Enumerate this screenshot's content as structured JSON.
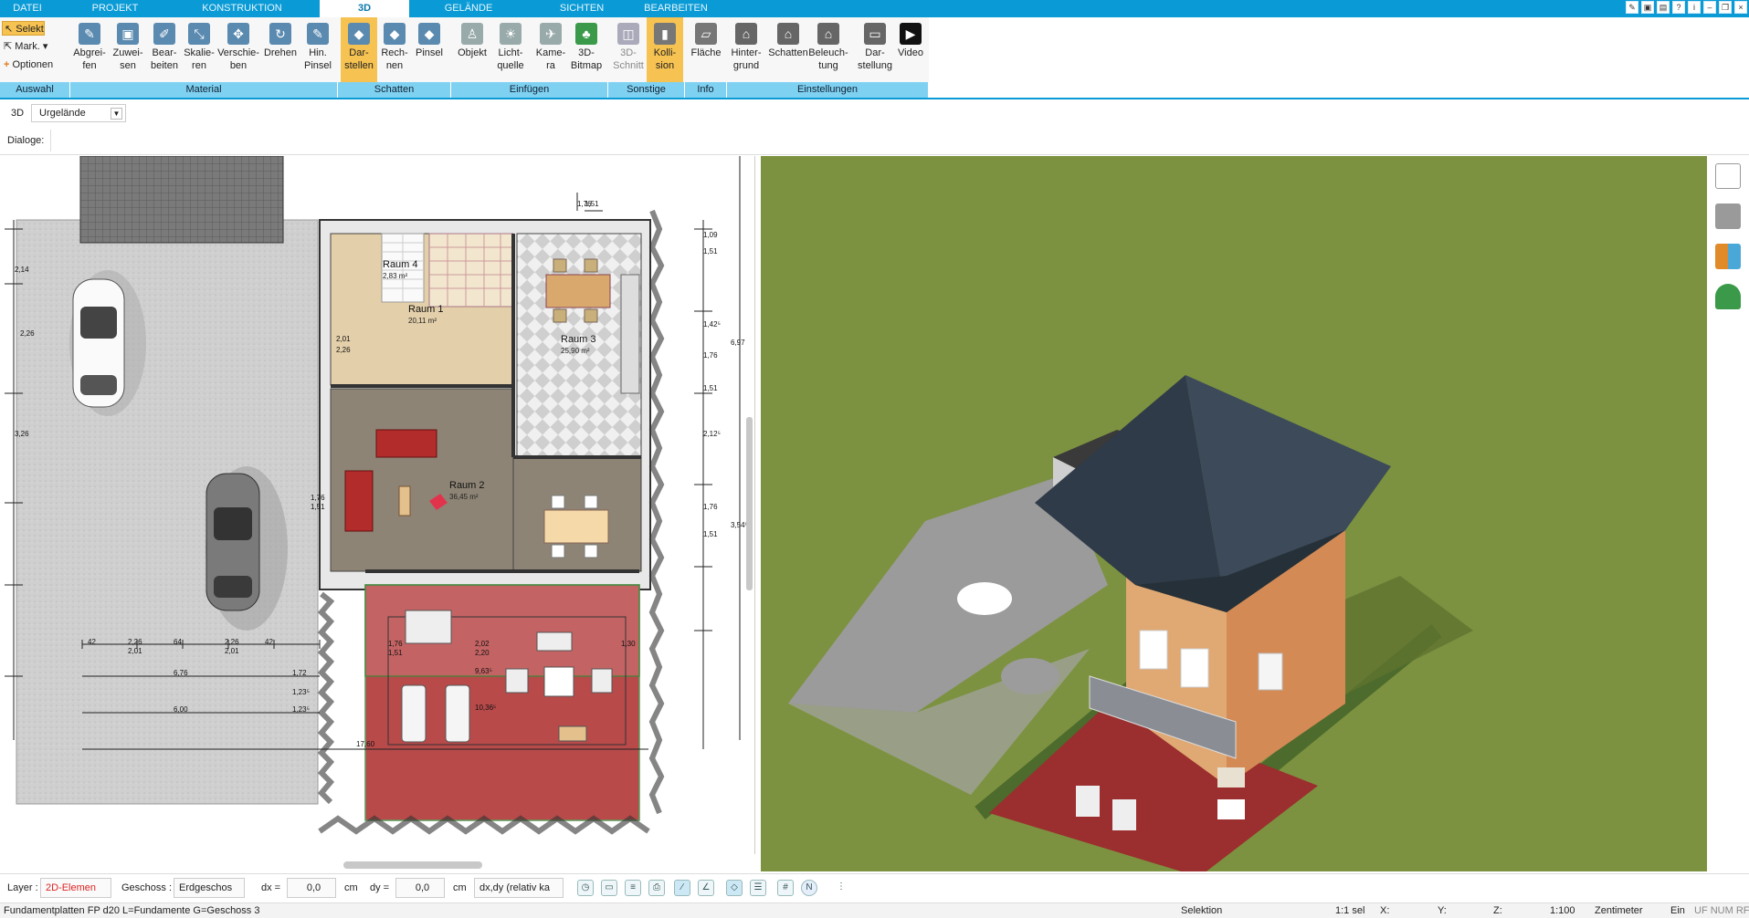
{
  "tabs": [
    {
      "label": "DATEI",
      "active": false
    },
    {
      "label": "PROJEKT",
      "active": false
    },
    {
      "label": "KONSTRUKTION",
      "active": false
    },
    {
      "label": "3D",
      "active": true
    },
    {
      "label": "GELÄNDE",
      "active": false
    },
    {
      "label": "SICHTEN",
      "active": false
    },
    {
      "label": "BEARBEITEN",
      "active": false
    }
  ],
  "selection_tools": {
    "select": "Selekt",
    "mark": "Mark.",
    "options": "Optionen"
  },
  "ribbon_buttons": [
    {
      "label": "Abgrei-\nfen",
      "icon": "eyedropper-icon"
    },
    {
      "label": "Zuwei-\nsen",
      "icon": "assign-material-icon"
    },
    {
      "label": "Bear-\nbeiten",
      "icon": "edit-material-icon"
    },
    {
      "label": "Skalie-\nren",
      "icon": "scale-icon"
    },
    {
      "label": "Verschie-\nben",
      "icon": "move-icon"
    },
    {
      "label": "Drehen",
      "icon": "rotate-icon"
    },
    {
      "label": "Hin.\nPinsel",
      "icon": "brush-icon"
    },
    {
      "label": "Dar-\nstellen",
      "icon": "shadow-display-icon",
      "active": true
    },
    {
      "label": "Rech-\nnen",
      "icon": "calculate-icon"
    },
    {
      "label": "Pinsel",
      "icon": "shadow-brush-icon"
    },
    {
      "label": "Objekt",
      "icon": "chair-icon"
    },
    {
      "label": "Licht-\nquelle",
      "icon": "lightbulb-icon"
    },
    {
      "label": "Kame-\nra",
      "icon": "camera-icon"
    },
    {
      "label": "3D-\nBitmap",
      "icon": "tree-icon"
    },
    {
      "label": "3D-\nSchnitt",
      "icon": "section-icon",
      "dim": true
    },
    {
      "label": "Kolli-\nsion",
      "icon": "collision-icon",
      "active": true
    },
    {
      "label": "Fläche",
      "icon": "area-info-icon"
    },
    {
      "label": "Hinter-\ngrund",
      "icon": "background-icon"
    },
    {
      "label": "Schatten",
      "icon": "house-shadow-icon"
    },
    {
      "label": "Beleuch-\ntung",
      "icon": "lighting-icon"
    },
    {
      "label": "Dar-\nstellung",
      "icon": "display-settings-icon"
    },
    {
      "label": "Video",
      "icon": "video-play-icon"
    }
  ],
  "groups": [
    "Auswahl",
    "Material",
    "Schatten",
    "Einfügen",
    "Sonstige",
    "Info",
    "Einstellungen"
  ],
  "view_bar": {
    "mode": "3D",
    "terrain": "Urgelände",
    "dialogs": "Dialoge:"
  },
  "plan": {
    "rooms": [
      {
        "name": "Raum 4",
        "area": "2,83 m²"
      },
      {
        "name": "Raum 1",
        "area": "20,11 m²"
      },
      {
        "name": "Raum 3",
        "area": "25,90 m²"
      },
      {
        "name": "Raum 2",
        "area": "36,45 m²"
      }
    ],
    "dimensions": [
      "1,76",
      "1,51",
      "1,09",
      "1,51",
      "1,42⁵",
      "1,76",
      "1,51",
      "2,12⁵",
      "1,76",
      "1,51",
      "6,97",
      "3,54⁵",
      "2,01",
      "2,26",
      "2,26",
      "2,01",
      "2,26",
      "2,01",
      "6,76",
      "6,00",
      "1,72",
      "1,23⁵",
      "1,23⁵",
      "1,76",
      "1,51",
      "2,02",
      "2,20",
      "1,30",
      "9,63⁵",
      "10,36⁵",
      "17,60",
      "42",
      "64",
      "42",
      "1,76",
      "1,51",
      "3,26",
      "2,14",
      "2,26"
    ]
  },
  "bottom": {
    "layer_label": "Layer :",
    "layer_value": "2D-Elemen",
    "floor_label": "Geschoss :",
    "floor_value": "Erdgeschos",
    "dx_label": "dx =",
    "dx_value": "0,0",
    "dx_unit": "cm",
    "dy_label": "dy =",
    "dy_value": "0,0",
    "dy_unit": "cm",
    "mode_value": "dx,dy (relativ ka"
  },
  "status": {
    "info": "Fundamentplatten FP d20 L=Fundamente G=Geschoss 3",
    "selection": "Selektion",
    "sel_count": "1:1 sel",
    "x": "X:",
    "y": "Y:",
    "z": "Z:",
    "scale": "1:100",
    "unit": "Zentimeter",
    "ein": "Ein",
    "flags": "UF  NUM  RF"
  },
  "colors": {
    "accent": "#0a9bd6",
    "group_bar": "#7fd1f2",
    "active_button": "#f6c251",
    "grass": "#7c9240",
    "terrace": "#b84a4a"
  }
}
